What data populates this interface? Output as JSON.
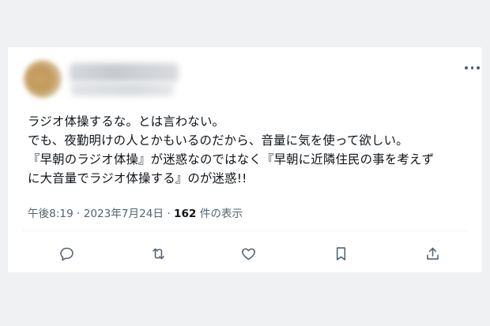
{
  "tweet": {
    "lines": [
      "ラジオ体操するな。とは言わない。",
      "でも、夜勤明けの人とかもいるのだから、音量に気を使って欲しい。",
      "『早朝のラジオ体操』が迷惑なのではなく『早朝に近隣住民の事を考えず",
      "に大音量でラジオ体操する』のが迷惑!!"
    ],
    "time": "午後8:19",
    "separator1": "·",
    "date": "2023年7月24日",
    "separator2": "·",
    "views_count": "162",
    "views_label": "件の表示"
  },
  "icons": {
    "more": "more-horizontal-icon",
    "reply": "reply-icon",
    "retweet": "retweet-icon",
    "like": "heart-icon",
    "bookmark": "bookmark-icon",
    "share": "share-icon"
  },
  "colors": {
    "text": "#0f1419",
    "secondary": "#536471",
    "background": "#f0f1f2",
    "card": "#ffffff"
  }
}
